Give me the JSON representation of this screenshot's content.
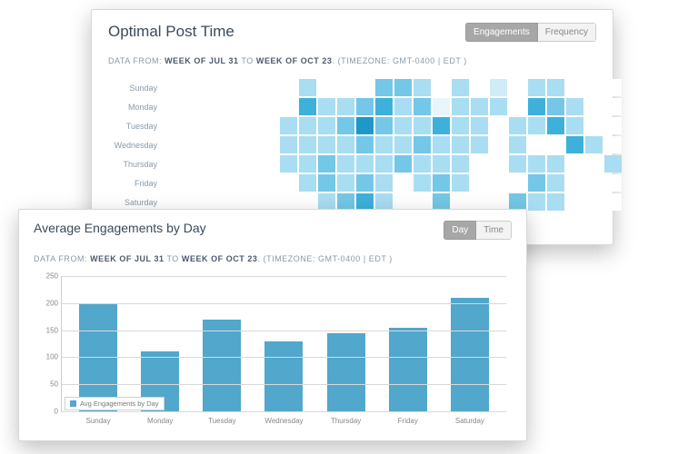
{
  "heatmap_panel": {
    "title": "Optimal Post Time",
    "toggle": {
      "active": "Engagements",
      "other": "Frequency"
    },
    "meta": {
      "prefix": "DATA FROM:",
      "from": "WEEK OF JUL 31",
      "to_word": "TO",
      "to": "WEEK OF OCT 23",
      "tz": "(TIMEZONE: GMT-0400 | EDT )"
    },
    "days": [
      "Sunday",
      "Monday",
      "Tuesday",
      "Wednesday",
      "Thursday",
      "Friday",
      "Saturday"
    ]
  },
  "bar_panel": {
    "title": "Average Engagements by Day",
    "toggle": {
      "active": "Day",
      "other": "Time"
    },
    "meta": {
      "prefix": "DATA FROM:",
      "from": "WEEK OF JUL 31",
      "to_word": "TO",
      "to": "WEEK OF OCT 23",
      "tz": "(TIMEZONE: GMT-0400 | EDT )"
    },
    "legend": "Avg Engagements by Day"
  },
  "chart_data": [
    {
      "type": "heatmap",
      "title": "Optimal Post Time",
      "ylabels": [
        "Sunday",
        "Monday",
        "Tuesday",
        "Wednesday",
        "Thursday",
        "Friday",
        "Saturday"
      ],
      "xrange_hours": 24,
      "values": [
        [
          0,
          0,
          0,
          0,
          0,
          0,
          0,
          3,
          0,
          0,
          0,
          4,
          4,
          3,
          0,
          3,
          0,
          2,
          0,
          3,
          3,
          0,
          0,
          0
        ],
        [
          0,
          0,
          0,
          0,
          0,
          0,
          0,
          5,
          3,
          3,
          4,
          5,
          3,
          4,
          1,
          3,
          3,
          3,
          0,
          5,
          4,
          3,
          0,
          0
        ],
        [
          0,
          0,
          0,
          0,
          0,
          0,
          3,
          3,
          3,
          4,
          6,
          4,
          3,
          3,
          5,
          3,
          3,
          0,
          3,
          3,
          5,
          3,
          0,
          0
        ],
        [
          0,
          0,
          0,
          0,
          0,
          0,
          3,
          3,
          3,
          3,
          4,
          3,
          3,
          4,
          3,
          3,
          3,
          0,
          3,
          0,
          0,
          5,
          3,
          0
        ],
        [
          0,
          0,
          0,
          0,
          0,
          0,
          3,
          3,
          4,
          3,
          3,
          3,
          4,
          3,
          3,
          3,
          0,
          0,
          3,
          3,
          3,
          0,
          0,
          3
        ],
        [
          0,
          0,
          0,
          0,
          0,
          0,
          0,
          3,
          4,
          3,
          4,
          3,
          0,
          3,
          4,
          3,
          0,
          0,
          0,
          4,
          3,
          0,
          0,
          0
        ],
        [
          0,
          0,
          0,
          0,
          0,
          0,
          0,
          0,
          3,
          4,
          5,
          3,
          0,
          0,
          4,
          0,
          0,
          0,
          4,
          3,
          3,
          0,
          0,
          0
        ]
      ],
      "scale_note": "0=empty, 1..6 increasing engagement intensity"
    },
    {
      "type": "bar",
      "title": "Average Engagements by Day",
      "categories": [
        "Sunday",
        "Monday",
        "Tuesday",
        "Wednesday",
        "Thursday",
        "Friday",
        "Saturday"
      ],
      "values": [
        200,
        110,
        170,
        130,
        145,
        155,
        210
      ],
      "xlabel": "",
      "ylabel": "",
      "yticks": [
        0,
        50,
        100,
        150,
        200,
        250
      ],
      "ylim": [
        0,
        250
      ],
      "legend": [
        "Avg Engagements by Day"
      ],
      "color": "#51a7cc"
    }
  ],
  "palette": {
    "heat0": "#ffffff",
    "heat1": "#e8f5fb",
    "heat2": "#d0ecf7",
    "heat3": "#a9ddf1",
    "heat4": "#74c7e6",
    "heat5": "#3eb1db",
    "heat6": "#1e98c8"
  }
}
